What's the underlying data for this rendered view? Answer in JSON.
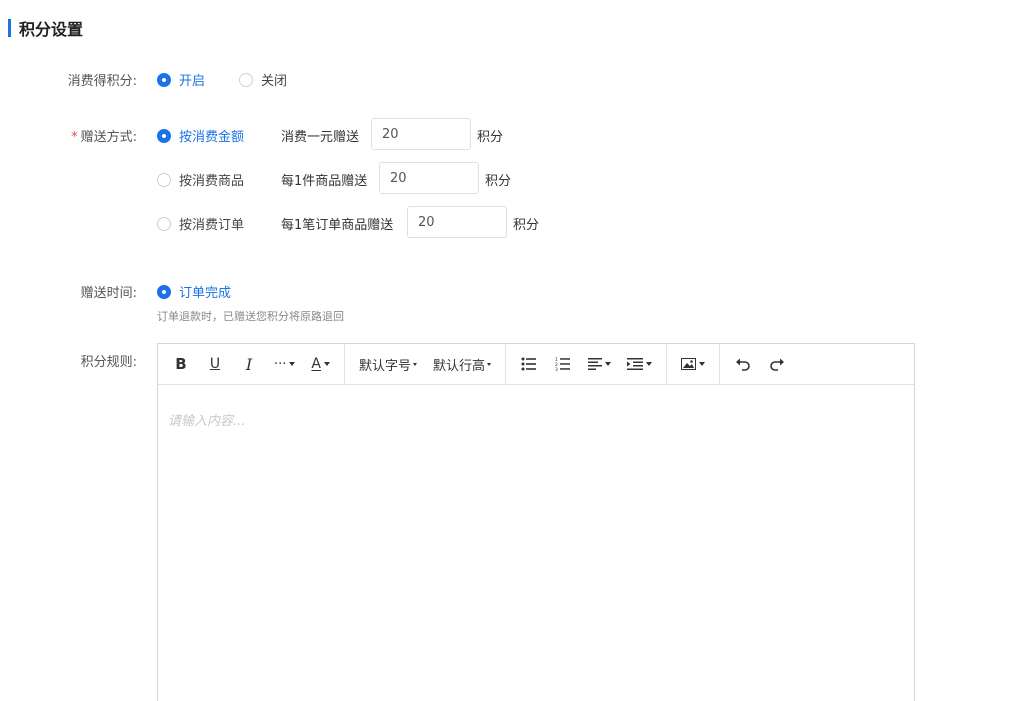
{
  "section": {
    "title": "积分设置"
  },
  "earn_points": {
    "label": "消费得积分:",
    "options": [
      {
        "label": "开启",
        "checked": true
      },
      {
        "label": "关闭",
        "checked": false
      }
    ]
  },
  "gift_method": {
    "required_mark": "*",
    "label": "赠送方式:",
    "options": [
      {
        "label": "按消费金额",
        "checked": true,
        "prefix": "消费一元赠送",
        "value": "20",
        "suffix": "积分"
      },
      {
        "label": "按消费商品",
        "checked": false,
        "prefix": "每1件商品赠送",
        "value": "20",
        "suffix": "积分"
      },
      {
        "label": "按消费订单",
        "checked": false,
        "prefix": "每1笔订单商品赠送",
        "value": "20",
        "suffix": "积分"
      }
    ]
  },
  "gift_time": {
    "label": "赠送时间:",
    "option": {
      "label": "订单完成",
      "checked": true
    },
    "hint": "订单退款时，已赠送您积分将原路退回"
  },
  "rules": {
    "label": "积分规则:",
    "toolbar": {
      "bold": "B",
      "underline": "U",
      "italic": "I",
      "more": "···",
      "font_color": "A",
      "font_size": "默认字号",
      "line_height": "默认行高"
    },
    "placeholder": "请输入内容..."
  },
  "colors": {
    "accent": "#1a73e8",
    "required": "#f04b4b"
  }
}
